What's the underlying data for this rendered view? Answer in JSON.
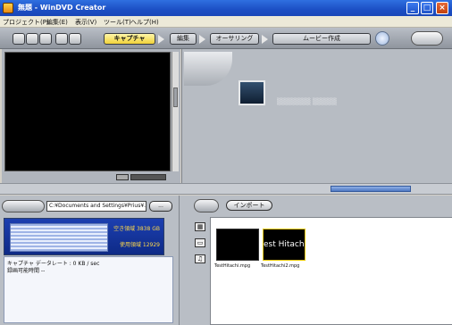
{
  "window": {
    "title": "無題 - WinDVD Creator"
  },
  "menu": [
    "プロジェクト(P)",
    "編集(E)",
    "表示(V)",
    "ツール(T)",
    "ヘルプ(H)"
  ],
  "toolbar": {
    "tabs": [
      "キャプチャ",
      "編集",
      "オーサリング",
      "ムービー作成"
    ]
  },
  "disk": {
    "free_label": "空き領域 3838 GB",
    "used_label": "使用領域 12929"
  },
  "path": {
    "value": "C:¥Documents and Settings¥Prius¥..",
    "browse_label": "..."
  },
  "info": {
    "data_rate": "キャプチャ データレート : 0 KB / sec",
    "recording_time": "録画可能時間 --"
  },
  "media": {
    "import_label": "インポート",
    "items": [
      {
        "name": "TestHitachi.mpg",
        "thumb_text": ""
      },
      {
        "name": "TestHitachi2.mpg",
        "thumb_text": "est Hitach"
      }
    ]
  },
  "colors": {
    "titlebar": "#1c4fc4",
    "capture_tab": "#f1d23a",
    "disk_panel": "#0e2a86",
    "disk_text": "#ffd94a"
  }
}
